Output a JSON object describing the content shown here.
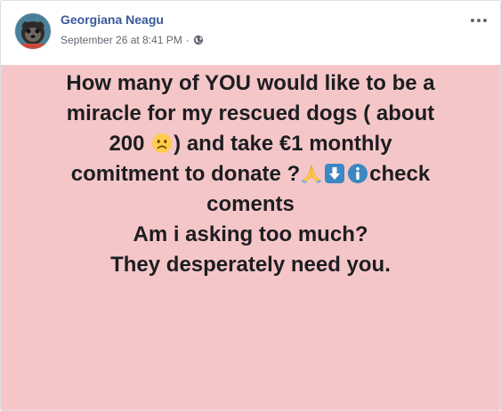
{
  "post": {
    "author": "Georgiana Neagu",
    "timestamp": "September 26 at 8:41 PM",
    "separator": "·",
    "privacy_icon": "globe-icon",
    "more_icon": "more-options-icon",
    "background_color": "#f5c6c8",
    "text": {
      "line1": "How many of YOU would like to be a",
      "line2": "miracle for my rescued dogs ( about",
      "line3_before": "200 ",
      "line3_emoji": "frowning-face-emoji",
      "line3_after": ") and take €1 monthly",
      "line4_before": "comitment to donate ?",
      "line4_emojis": [
        "folded-hands-emoji",
        "down-arrow-emoji",
        "information-emoji"
      ],
      "line4_after": "check",
      "line5": "coments",
      "line6": "Am i asking too much?",
      "line7": "They desperately need you."
    }
  },
  "colors": {
    "author_link": "#385898",
    "meta_text": "#606770",
    "post_text": "#1c1e21",
    "keycap_blue": "#3b88c3",
    "emoji_yellow": "#ffcc4d"
  }
}
